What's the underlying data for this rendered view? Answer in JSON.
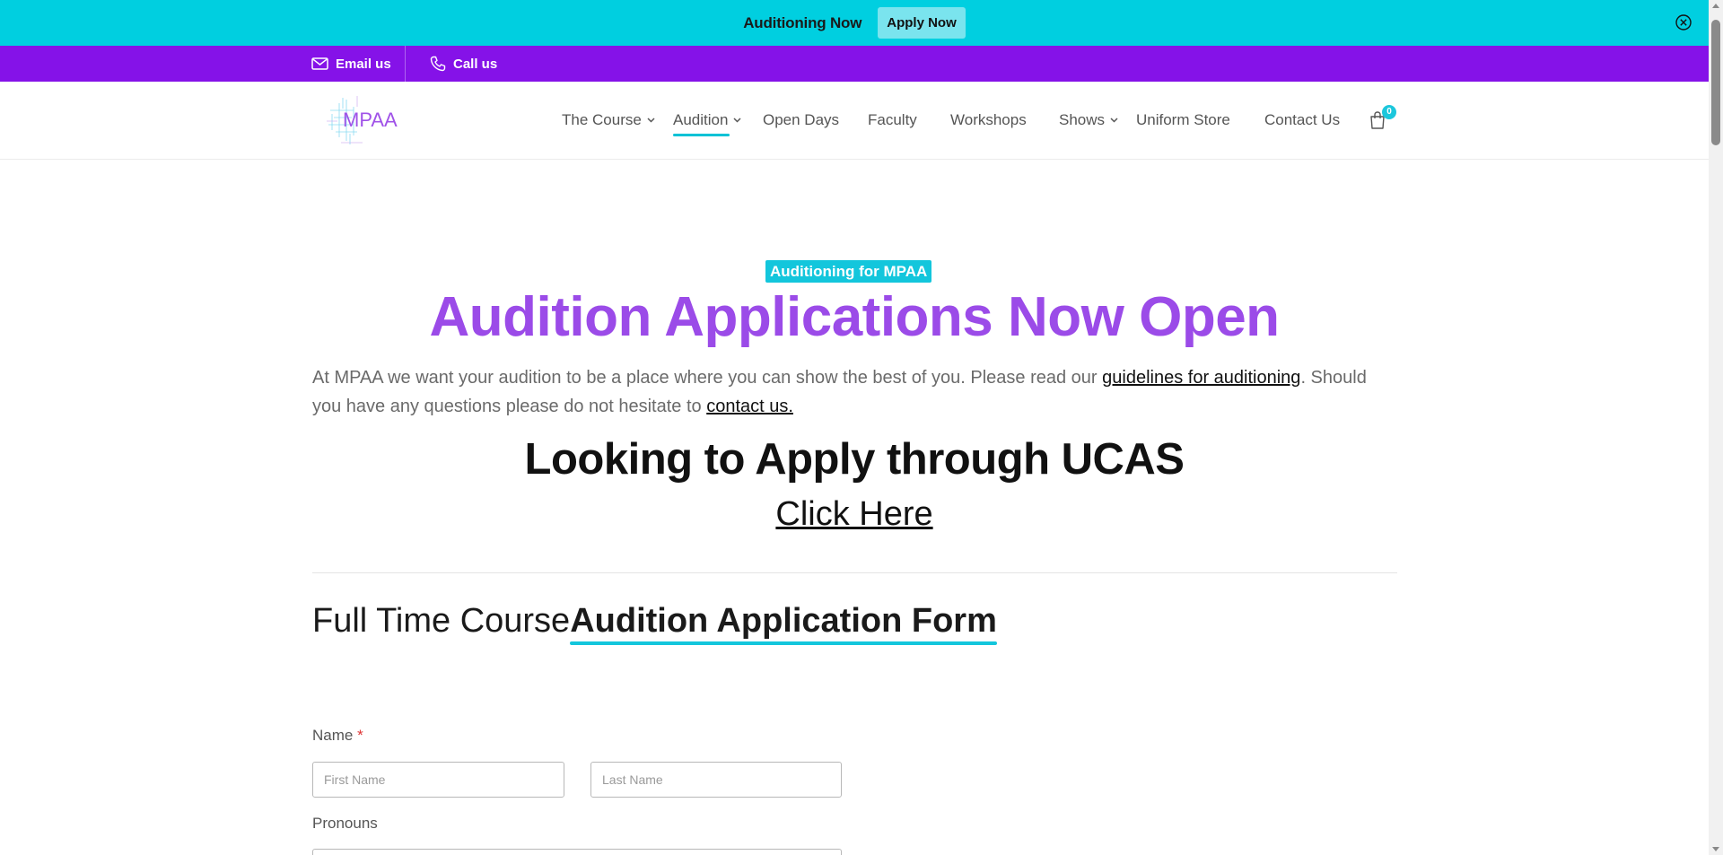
{
  "announcement": {
    "text": "Auditioning Now",
    "button_label": "Apply Now"
  },
  "contact_bar": {
    "email_label": "Email us",
    "call_label": "Call us"
  },
  "header": {
    "logo_text": "MPAA",
    "nav": [
      {
        "label": "The Course",
        "has_dropdown": true
      },
      {
        "label": "Audition",
        "has_dropdown": true,
        "active": true
      },
      {
        "label": "Open Days",
        "has_dropdown": false
      },
      {
        "label": "Faculty",
        "has_dropdown": false
      },
      {
        "label": "Workshops",
        "has_dropdown": false
      },
      {
        "label": "Shows",
        "has_dropdown": true
      },
      {
        "label": "Uniform Store",
        "has_dropdown": false
      },
      {
        "label": "Contact Us",
        "has_dropdown": false
      }
    ],
    "cart_count": "0"
  },
  "hero": {
    "kicker": "Auditioning for MPAA",
    "title": "Audition Applications Now Open",
    "intro_part1": "At MPAA we want your audition to be a place where you can show the best of you. Please read our ",
    "intro_link1": "guidelines for auditioning",
    "intro_part2": ". Should you have any questions please do not hesitate to ",
    "intro_link2": "contact us."
  },
  "ucas": {
    "title": "Looking to Apply through UCAS",
    "link": "Click Here"
  },
  "form": {
    "title_light": "Full Time Course",
    "title_strong": "Audition Application Form",
    "name_label": "Name",
    "required_mark": "*",
    "first_name_placeholder": "First Name",
    "last_name_placeholder": "Last Name",
    "pronouns_label": "Pronouns"
  },
  "colors": {
    "announcement_bg": "#00cfe0",
    "contact_bar_bg": "#8512e8",
    "hero_title": "#9b4be8",
    "accent": "#13c6dc"
  }
}
